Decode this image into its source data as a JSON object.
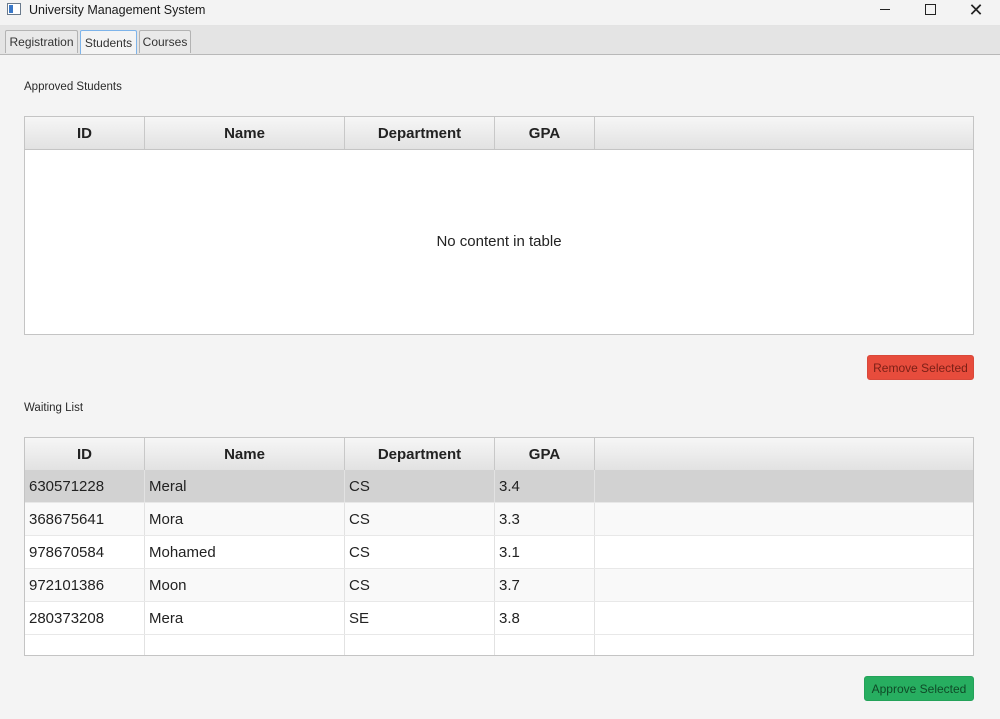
{
  "window": {
    "title": "University Management System",
    "icon": "app-window-icon"
  },
  "tabs": [
    {
      "label": "Registration",
      "active": false
    },
    {
      "label": "Students",
      "active": true
    },
    {
      "label": "Courses",
      "active": false
    }
  ],
  "columns": [
    "ID",
    "Name",
    "Department",
    "GPA"
  ],
  "approved": {
    "label": "Approved Students",
    "placeholder": "No content in table",
    "rows": []
  },
  "remove_button": {
    "label": "Remove Selected",
    "color": "#e74c3c"
  },
  "waiting": {
    "label": "Waiting List",
    "rows": [
      {
        "id": "630571228",
        "name": "Meral",
        "department": "CS",
        "gpa": "3.4",
        "selected": true
      },
      {
        "id": "368675641",
        "name": "Mora",
        "department": "CS",
        "gpa": "3.3",
        "selected": false
      },
      {
        "id": "978670584",
        "name": "Mohamed",
        "department": "CS",
        "gpa": "3.1",
        "selected": false
      },
      {
        "id": "972101386",
        "name": "Moon",
        "department": "CS",
        "gpa": "3.7",
        "selected": false
      },
      {
        "id": "280373208",
        "name": "Mera",
        "department": "SE",
        "gpa": "3.8",
        "selected": false
      }
    ]
  },
  "approve_button": {
    "label": "Approve Selected",
    "color": "#27ae60"
  }
}
